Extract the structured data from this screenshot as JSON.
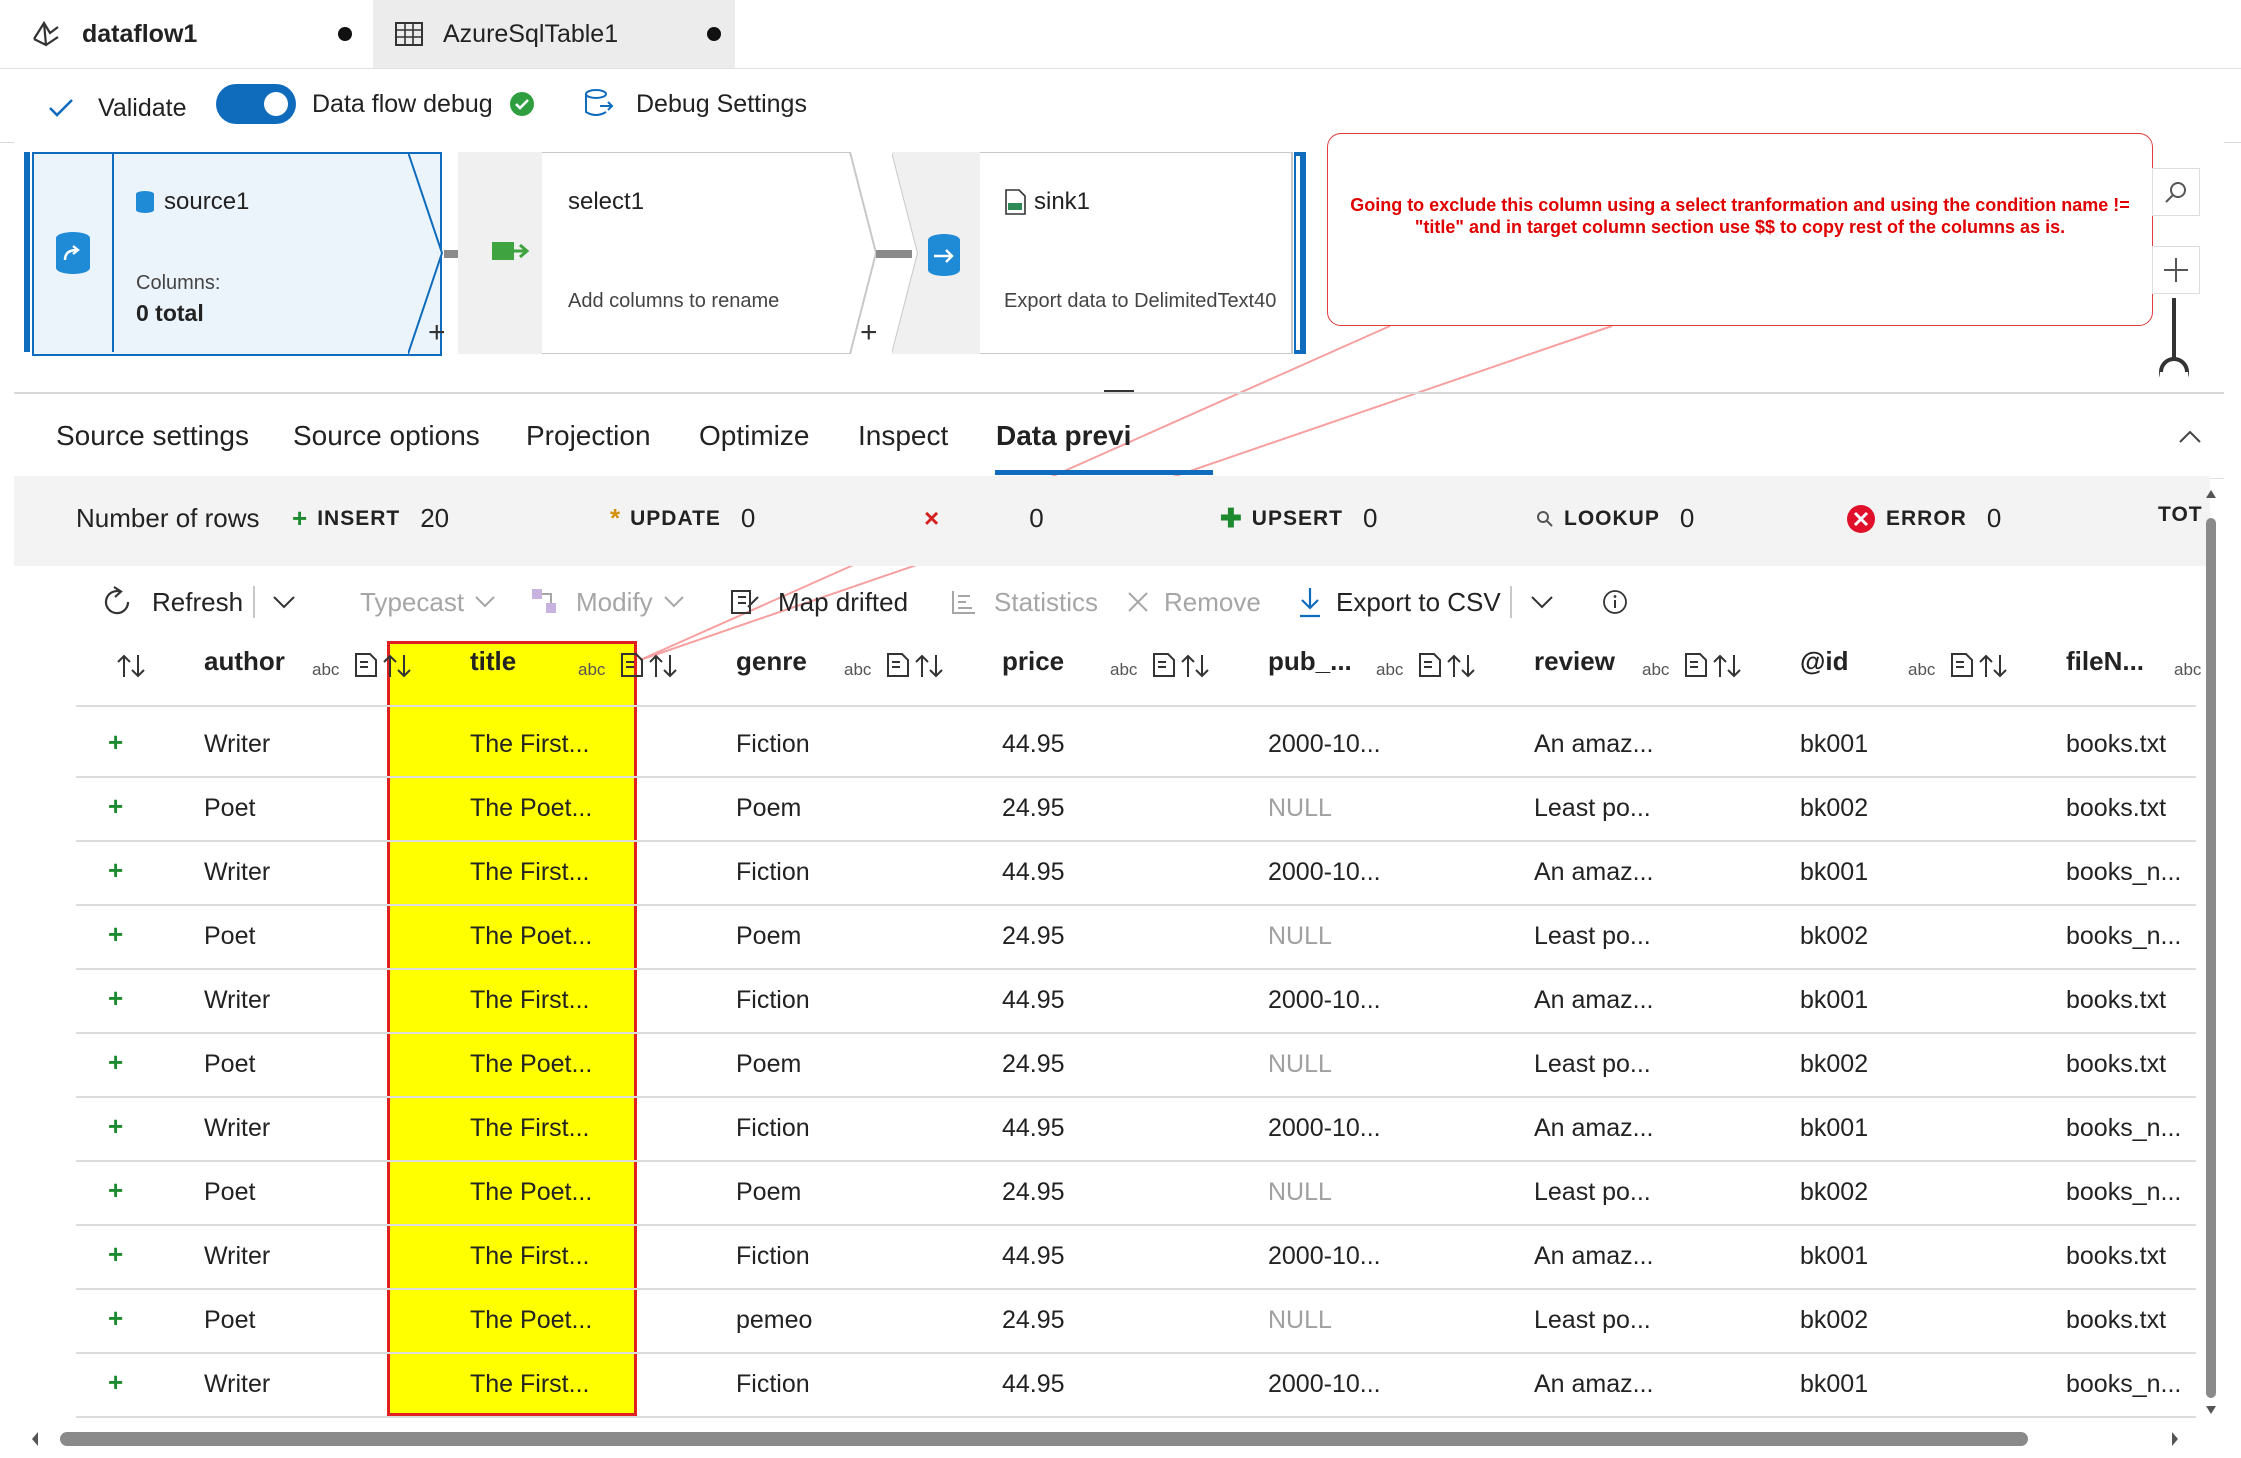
{
  "tabs": [
    {
      "label": "dataflow1",
      "icon": "dataflow-icon"
    },
    {
      "label": "AzureSqlTable1",
      "icon": "table-icon"
    }
  ],
  "toolbar": {
    "validate": "Validate",
    "debug": "Data flow debug",
    "debug_settings": "Debug Settings"
  },
  "nodes": {
    "source": {
      "title": "source1",
      "sub1": "Columns:",
      "sub2": "0 total"
    },
    "select": {
      "title": "select1",
      "sub": "Add columns to rename"
    },
    "sink": {
      "title": "sink1",
      "sub": "Export data to DelimitedText40"
    }
  },
  "annotation": "Going to exclude this column using a select tranformation and using the condition name != \"title\" and in target column section use $$ to copy rest of the columns as is.",
  "panel_tabs": [
    "Source settings",
    "Source options",
    "Projection",
    "Optimize",
    "Inspect",
    "Data previ"
  ],
  "stats": {
    "label": "Number of rows",
    "insert": {
      "k": "INSERT",
      "v": "20"
    },
    "update": {
      "k": "UPDATE",
      "v": "0"
    },
    "delete_v": "0",
    "upsert": {
      "k": "UPSERT",
      "v": "0"
    },
    "lookup": {
      "k": "LOOKUP",
      "v": "0"
    },
    "error": {
      "k": "ERROR",
      "v": "0"
    },
    "total": "TOT"
  },
  "grid_toolbar": {
    "refresh": "Refresh",
    "typecast": "Typecast",
    "modify": "Modify",
    "map_drifted": "Map drifted",
    "statistics": "Statistics",
    "remove": "Remove",
    "export": "Export to CSV"
  },
  "columns": [
    "author",
    "title",
    "genre",
    "price",
    "pub_...",
    "review",
    "@id",
    "fileN..."
  ],
  "type_label": "abc",
  "rows": [
    [
      "Writer",
      "The First...",
      "Fiction",
      "44.95",
      "2000-10...",
      "An amaz...",
      "bk001",
      "books.txt"
    ],
    [
      "Poet",
      "The Poet...",
      "Poem",
      "24.95",
      "NULL",
      "Least po...",
      "bk002",
      "books.txt"
    ],
    [
      "Writer",
      "The First...",
      "Fiction",
      "44.95",
      "2000-10...",
      "An amaz...",
      "bk001",
      "books_n..."
    ],
    [
      "Poet",
      "The Poet...",
      "Poem",
      "24.95",
      "NULL",
      "Least po...",
      "bk002",
      "books_n..."
    ],
    [
      "Writer",
      "The First...",
      "Fiction",
      "44.95",
      "2000-10...",
      "An amaz...",
      "bk001",
      "books.txt"
    ],
    [
      "Poet",
      "The Poet...",
      "Poem",
      "24.95",
      "NULL",
      "Least po...",
      "bk002",
      "books.txt"
    ],
    [
      "Writer",
      "The First...",
      "Fiction",
      "44.95",
      "2000-10...",
      "An amaz...",
      "bk001",
      "books_n..."
    ],
    [
      "Poet",
      "The Poet...",
      "Poem",
      "24.95",
      "NULL",
      "Least po...",
      "bk002",
      "books_n..."
    ],
    [
      "Writer",
      "The First...",
      "Fiction",
      "44.95",
      "2000-10...",
      "An amaz...",
      "bk001",
      "books.txt"
    ],
    [
      "Poet",
      "The Poet...",
      "pemeo",
      "24.95",
      "NULL",
      "Least po...",
      "bk002",
      "books.txt"
    ],
    [
      "Writer",
      "The First...",
      "Fiction",
      "44.95",
      "2000-10...",
      "An amaz...",
      "bk001",
      "books_n..."
    ]
  ],
  "colors": {
    "accent": "#0f6cbd",
    "highlight": "#ffff00",
    "annotation": "#e00000",
    "insert": "#1e8a2f"
  }
}
